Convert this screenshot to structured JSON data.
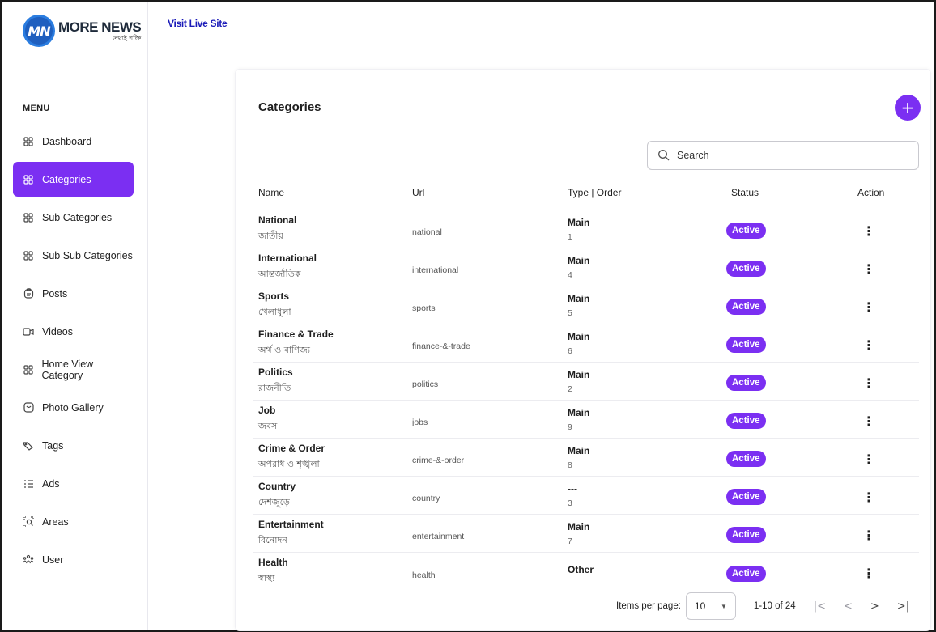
{
  "logo": {
    "mark": "MN",
    "name": "MORE NEWS",
    "tagline": "তথ্যই শক্তি"
  },
  "topbar": {
    "visit_live_site": "Visit Live Site"
  },
  "sidebar": {
    "heading": "MENU",
    "items": [
      {
        "label": "Dashboard",
        "icon": "grid-icon"
      },
      {
        "label": "Categories",
        "icon": "grid-icon",
        "active": true
      },
      {
        "label": "Sub Categories",
        "icon": "grid-icon"
      },
      {
        "label": "Sub Sub Categories",
        "icon": "grid-icon"
      },
      {
        "label": "Posts",
        "icon": "clipboard-icon"
      },
      {
        "label": "Videos",
        "icon": "video-icon"
      },
      {
        "label": "Home View Category",
        "icon": "grid-icon"
      },
      {
        "label": "Photo Gallery",
        "icon": "image-icon"
      },
      {
        "label": "Tags",
        "icon": "tag-icon"
      },
      {
        "label": "Ads",
        "icon": "list-icon"
      },
      {
        "label": "Areas",
        "icon": "location-search-icon"
      },
      {
        "label": "User",
        "icon": "users-icon"
      }
    ]
  },
  "main": {
    "title": "Categories",
    "add_button": "+",
    "search_placeholder": "Search",
    "columns": {
      "name": "Name",
      "url": "Url",
      "type_order": "Type | Order",
      "status": "Status",
      "action": "Action"
    },
    "rows": [
      {
        "name": "National",
        "name_bn": "জাতীয়",
        "url": "national",
        "type": "Main",
        "order": "1",
        "status": "Active"
      },
      {
        "name": "International",
        "name_bn": "আন্তর্জাতিক",
        "url": "international",
        "type": "Main",
        "order": "4",
        "status": "Active"
      },
      {
        "name": "Sports",
        "name_bn": "খেলাধুলা",
        "url": "sports",
        "type": "Main",
        "order": "5",
        "status": "Active"
      },
      {
        "name": "Finance & Trade",
        "name_bn": "অর্থ ও বাণিজ্য",
        "url": "finance-&-trade",
        "type": "Main",
        "order": "6",
        "status": "Active"
      },
      {
        "name": "Politics",
        "name_bn": "রাজনীতি",
        "url": "politics",
        "type": "Main",
        "order": "2",
        "status": "Active"
      },
      {
        "name": "Job",
        "name_bn": "জবস",
        "url": "jobs",
        "type": "Main",
        "order": "9",
        "status": "Active"
      },
      {
        "name": "Crime & Order",
        "name_bn": "অপরাধ ও শৃঙ্খলা",
        "url": "crime-&-order",
        "type": "Main",
        "order": "8",
        "status": "Active"
      },
      {
        "name": "Country",
        "name_bn": "দেশজুড়ে",
        "url": "country",
        "type": "---",
        "order": "3",
        "status": "Active"
      },
      {
        "name": "Entertainment",
        "name_bn": "বিনোদন",
        "url": "entertainment",
        "type": "Main",
        "order": "7",
        "status": "Active"
      },
      {
        "name": "Health",
        "name_bn": "স্বাস্থ্য",
        "url": "health",
        "type": "Other",
        "order": "",
        "status": "Active"
      }
    ],
    "pagination": {
      "items_per_page_label": "Items per page:",
      "items_per_page": "10",
      "range": "1-10 of 24"
    }
  },
  "colors": {
    "accent": "#7b2ff2",
    "link": "#1a1ab8"
  }
}
